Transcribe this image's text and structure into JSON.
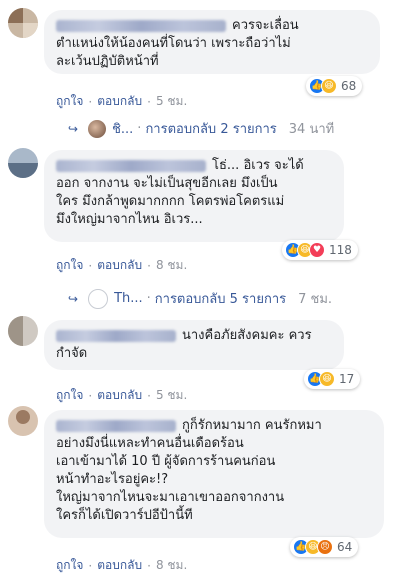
{
  "actions": {
    "like": "ถูกใจ",
    "reply": "ตอบกลับ",
    "sep": "·"
  },
  "comments": [
    {
      "text": "ควรจะเลื่อน\nตำแหน่งให้น้องคนที่โดนว่า เพราะถือว่าไม่\nละเว้นปฏิบัติหน้าที่",
      "reaction_count": "68",
      "time": "5 ชม.",
      "reply_summary": {
        "name": "ชิ...",
        "label": "การตอบกลับ 2 รายการ",
        "time": "34 นาที"
      }
    },
    {
      "text": "โธ่... อิเวร จะได้\nออก จากงาน จะไม่เป็นสุขอีกเลย มึงเป็น\nใคร มึงกล้าพูดมากกกก โคตรพ่อโคตรแม่\nมึงใหญ่มาจากไหน อิเวร...",
      "reaction_count": "118",
      "time": "8 ชม.",
      "reply_summary": {
        "name": "Th...",
        "label": "การตอบกลับ 5 รายการ",
        "time": "7 ชม."
      }
    },
    {
      "text": "นางคือภัยสังคมคะ ควร\nกำจัด",
      "reaction_count": "17",
      "time": "5 ชม."
    },
    {
      "text": "กูก็รักหมามาก คนรักหมา\nอย่างมึงนี่แหละทำคนอื่นเดือดร้อน\nเอาเข้ามาได้ 10 ปี ผู้จัดการร้านคนก่อน\nหน้าทำอะไรอยู่คะ!?\nใหญ่มาจากไหนจะมาเอาเขาออกจากงาน\nใครก็ได้เปิดวาร์ปอีป้านี้ที",
      "reaction_count": "64",
      "time": "8 ชม."
    }
  ],
  "colors": {
    "link": "#385898",
    "bubble": "#f2f3f5",
    "muted": "#90949c",
    "like": "#1877f2"
  },
  "icons": {
    "like": "like-reaction-icon",
    "haha": "haha-reaction-icon",
    "angry": "angry-reaction-icon",
    "love": "love-reaction-icon",
    "reply_arrow": "reply-arrow-icon"
  }
}
